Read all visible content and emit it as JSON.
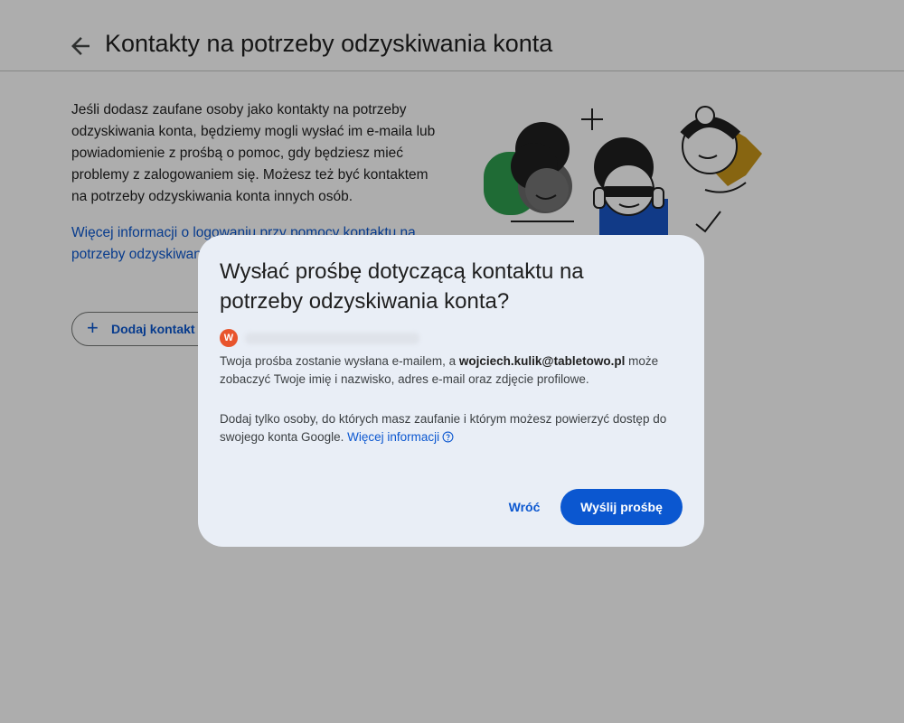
{
  "header": {
    "title": "Kontakty na potrzeby odzyskiwania konta"
  },
  "intro": {
    "text": "Jeśli dodasz zaufane osoby jako kontakty na potrzeby odzyskiwania konta, będziemy mogli wysłać im e-maila lub powiadomienie z prośbą o pomoc, gdy będziesz mieć problemy z zalogowaniem się. Możesz też być kontaktem na potrzeby odzyskiwania konta innych osób.",
    "link_text": "Więcej informacji o logowaniu przy pomocy kontaktu na potrzeby odzyskiwania konta"
  },
  "add_contact": {
    "label": "Dodaj kontakt na potrzeby odzyskiwania konta"
  },
  "dialog": {
    "title": "Wysłać prośbę dotyczącą kontaktu na potrzeby odzyskiwania konta?",
    "account_initial": "W",
    "body1_prefix": "Twoja prośba zostanie wysłana e-mailem, a ",
    "body1_email": "wojciech.kulik@tabletowo.pl",
    "body1_suffix": " może zobaczyć Twoje imię i nazwisko, adres e-mail oraz zdjęcie profilowe.",
    "body2_text": "Dodaj tylko osoby, do których masz zaufanie i którym możesz powierzyć dostęp do swojego konta Google. ",
    "body2_link": "Więcej informacji",
    "back_label": "Wróć",
    "send_label": "Wyślij prośbę"
  },
  "icons": [
    "back-arrow-icon",
    "plus-icon",
    "help-circle-icon"
  ],
  "colors": {
    "accent": "#0b57d0",
    "dialog_bg": "#e9eef6",
    "avatar": "#e8542c",
    "scrim": "rgba(0,0,0,0.32)"
  }
}
